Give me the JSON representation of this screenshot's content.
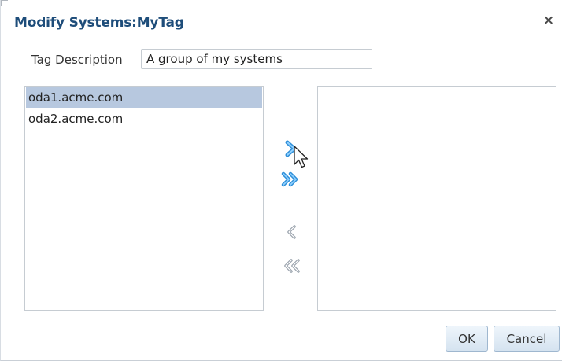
{
  "dialog": {
    "title": "Modify Systems:MyTag",
    "close_icon": "close-icon",
    "close_glyph": "×"
  },
  "tag_description": {
    "label": "Tag Description",
    "value": "A group of my systems"
  },
  "available_list": {
    "items": [
      {
        "label": "oda1.acme.com",
        "selected": true
      },
      {
        "label": "oda2.acme.com",
        "selected": false
      }
    ]
  },
  "selected_list": {
    "items": []
  },
  "shuttle_controls": {
    "move": "move-right-icon",
    "move_all": "move-all-right-icon",
    "remove": "move-left-icon",
    "remove_all": "move-all-left-icon",
    "active_color": "#2f8fd8",
    "disabled_color": "#9aa3ad"
  },
  "buttons": {
    "ok": "OK",
    "cancel": "Cancel"
  },
  "colors": {
    "title": "#1e4d7a",
    "selection": "#b7c8df"
  }
}
